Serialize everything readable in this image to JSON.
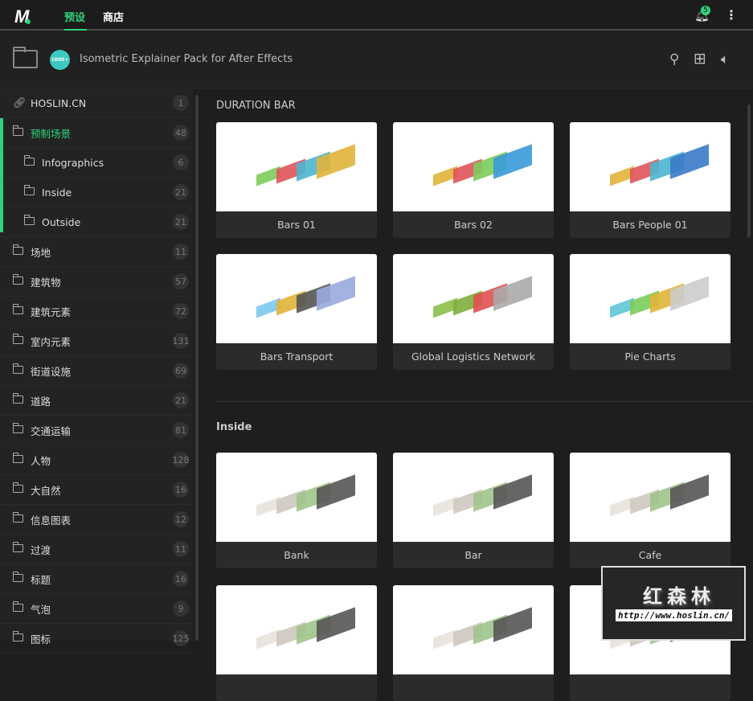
{
  "topbar": {
    "tabs": [
      {
        "label": "预设",
        "active": true
      },
      {
        "label": "商店",
        "active": false
      }
    ],
    "notification_count": "5"
  },
  "header": {
    "pack_badge": "1000+",
    "pack_title": "Isometric Explainer Pack for After Effects"
  },
  "sidebar": {
    "items": [
      {
        "label": "HOSLIN.CN",
        "count": "1",
        "icon": "link-icon"
      },
      {
        "label": "预制场景",
        "count": "48",
        "icon": "folder-open-icon",
        "active": true
      },
      {
        "label": "Infographics",
        "count": "6",
        "icon": "folder-icon",
        "sub": true
      },
      {
        "label": "Inside",
        "count": "21",
        "icon": "folder-icon",
        "sub": true
      },
      {
        "label": "Outside",
        "count": "21",
        "icon": "folder-icon",
        "sub": true
      },
      {
        "label": "场地",
        "count": "11",
        "icon": "folder-icon"
      },
      {
        "label": "建筑物",
        "count": "57",
        "icon": "folder-icon"
      },
      {
        "label": "建筑元素",
        "count": "72",
        "icon": "folder-icon"
      },
      {
        "label": "室内元素",
        "count": "131",
        "icon": "folder-icon"
      },
      {
        "label": "街道设施",
        "count": "69",
        "icon": "folder-icon"
      },
      {
        "label": "道路",
        "count": "21",
        "icon": "folder-icon"
      },
      {
        "label": "交通运输",
        "count": "81",
        "icon": "folder-icon"
      },
      {
        "label": "人物",
        "count": "128",
        "icon": "folder-icon"
      },
      {
        "label": "大自然",
        "count": "16",
        "icon": "folder-icon"
      },
      {
        "label": "信息图表",
        "count": "12",
        "icon": "folder-icon"
      },
      {
        "label": "过渡",
        "count": "11",
        "icon": "folder-icon"
      },
      {
        "label": "标题",
        "count": "16",
        "icon": "folder-icon"
      },
      {
        "label": "气泡",
        "count": "9",
        "icon": "folder-icon"
      },
      {
        "label": "图标",
        "count": "125",
        "icon": "folder-icon"
      }
    ]
  },
  "sections": [
    {
      "title": "DURATION BAR",
      "cards": [
        "Bars 01",
        "Bars 02",
        "Bars People 01",
        "Bars Transport",
        "Global Logistics Network",
        "Pie Charts"
      ]
    },
    {
      "title": "Inside",
      "cards": [
        "Bank",
        "Bar",
        "Cafe",
        "",
        "",
        ""
      ]
    }
  ],
  "watermark": {
    "text": "红森林",
    "url": "http://www.hoslin.cn/"
  },
  "colors": {
    "accent": "#2fd37a",
    "background": "#1e1e1e"
  }
}
